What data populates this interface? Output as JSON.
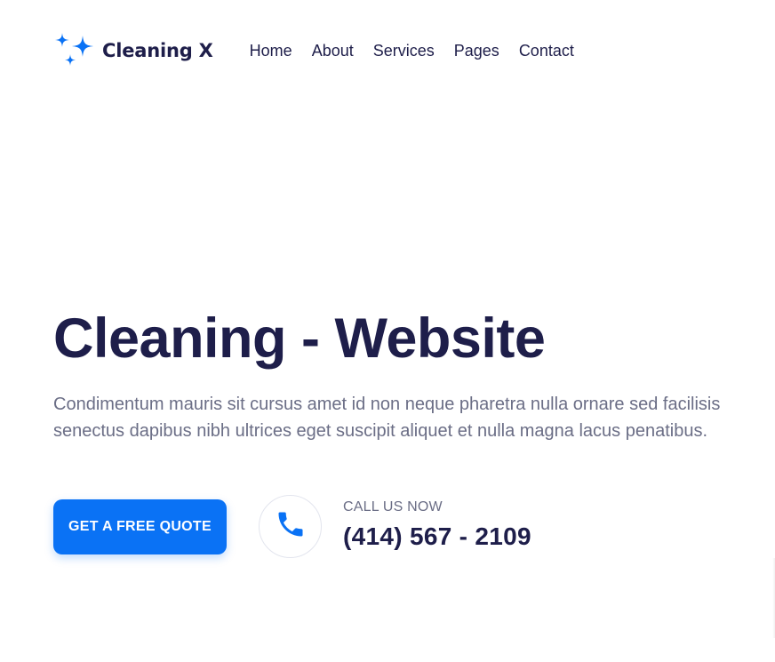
{
  "brand": {
    "name": "Cleaning X",
    "icon": "sparkle-icon",
    "accent_color": "#0a72f5"
  },
  "nav": {
    "items": [
      {
        "label": "Home"
      },
      {
        "label": "About"
      },
      {
        "label": "Services"
      },
      {
        "label": "Pages"
      },
      {
        "label": "Contact"
      }
    ]
  },
  "hero": {
    "title": "Cleaning - Website",
    "description": "Condimentum mauris sit cursus amet id non neque pharetra nulla ornare sed facilisis senectus dapibus nibh ultrices eget suscipit aliquet et nulla magna lacus penatibus.",
    "cta_label": "GET A FREE QUOTE",
    "call": {
      "label": "CALL US NOW",
      "number": "(414) 567 - 2109",
      "icon": "phone-icon"
    }
  },
  "colors": {
    "heading": "#1e1e4a",
    "body_text": "#6b6e86",
    "button": "#0a72f5"
  }
}
